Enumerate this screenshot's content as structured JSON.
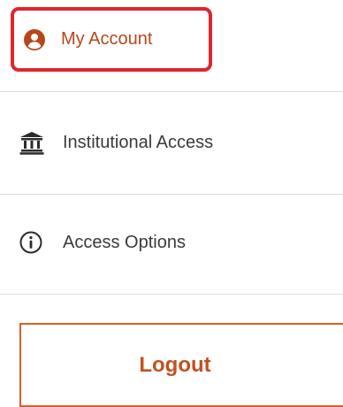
{
  "menu": {
    "my_account": {
      "label": "My Account",
      "icon": "user-circle-icon"
    },
    "institutional_access": {
      "label": "Institutional Access",
      "icon": "bank-icon"
    },
    "access_options": {
      "label": "Access Options",
      "icon": "info-circle-icon"
    },
    "logout": {
      "label": "Logout"
    }
  },
  "colors": {
    "accent": "#c2511f",
    "highlight_border": "#e0262b",
    "text": "#3a3a3a",
    "divider": "#dcdcdc"
  }
}
